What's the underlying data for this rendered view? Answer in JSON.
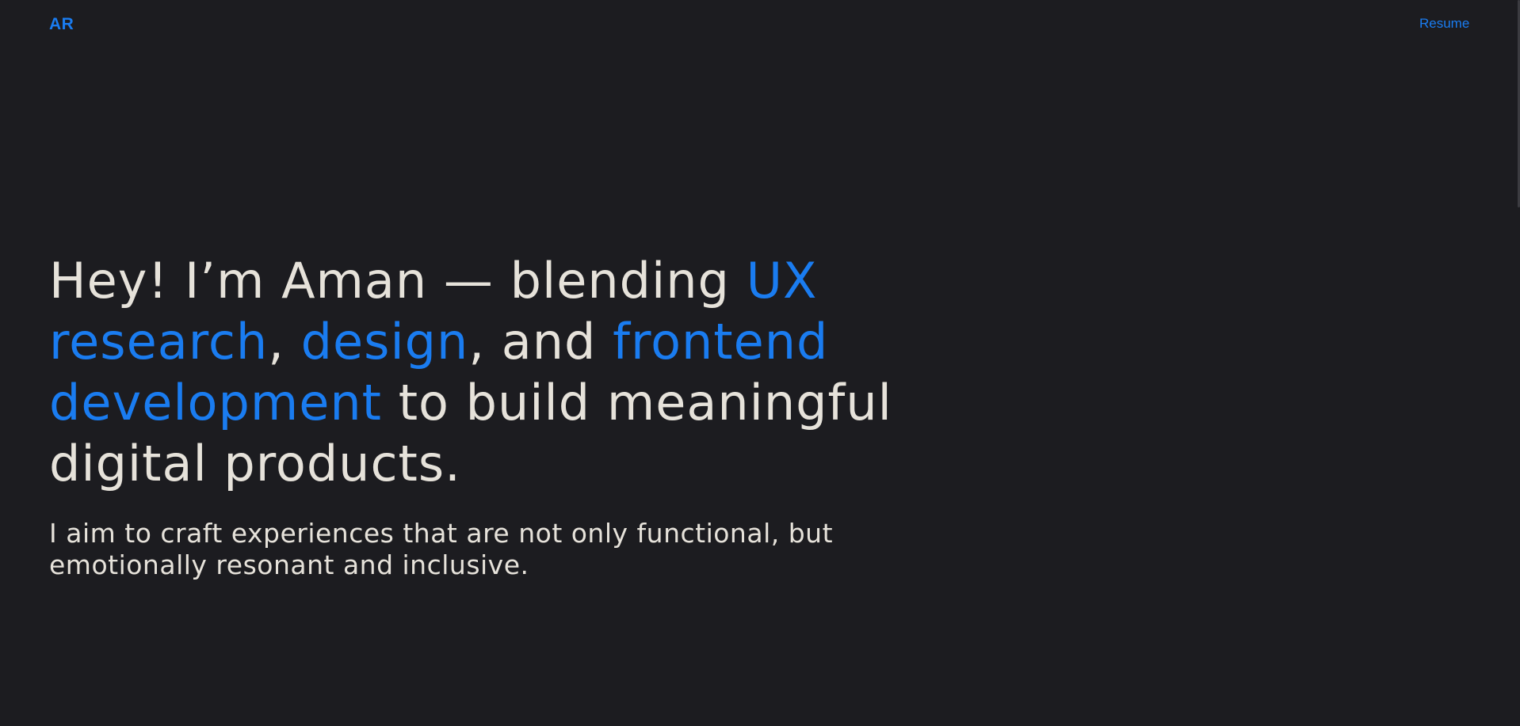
{
  "header": {
    "logo": "AR",
    "nav_resume": "Resume"
  },
  "hero": {
    "headline": {
      "p1": "Hey! I’m Aman — blending ",
      "h1": "UX research",
      "p2": ", ",
      "h2": "design",
      "p3": ", and ",
      "h3": "frontend development",
      "p4": " to build meaningful digital products."
    },
    "subtitle": "I aim to craft experiences that are not only functional, but emotionally resonant and inclusive."
  },
  "colors": {
    "background": "#1c1c20",
    "text": "#e6e2da",
    "accent": "#1a7cf0"
  }
}
